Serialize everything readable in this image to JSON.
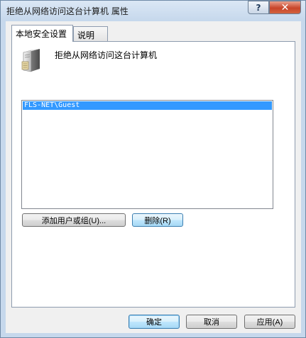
{
  "window": {
    "title": "拒绝从网络访问这台计算机 属性",
    "help_glyph": "?",
    "close_glyph": "✕"
  },
  "tabs": [
    {
      "label": "本地安全设置",
      "active": true
    },
    {
      "label": "说明",
      "active": false
    }
  ],
  "policy": {
    "icon": "server-icon",
    "title": "拒绝从网络访问这台计算机"
  },
  "accounts": {
    "items": [
      "FLS-NET\\Guest"
    ],
    "selected_index": 0
  },
  "buttons": {
    "add": "添加用户或组(U)...",
    "remove": "删除(R)",
    "ok": "确定",
    "cancel": "取消",
    "apply": "应用(A)"
  },
  "colors": {
    "selection": "#3399ff",
    "close_button": "#c8452a",
    "title_gradient": "#dbe7f5"
  }
}
